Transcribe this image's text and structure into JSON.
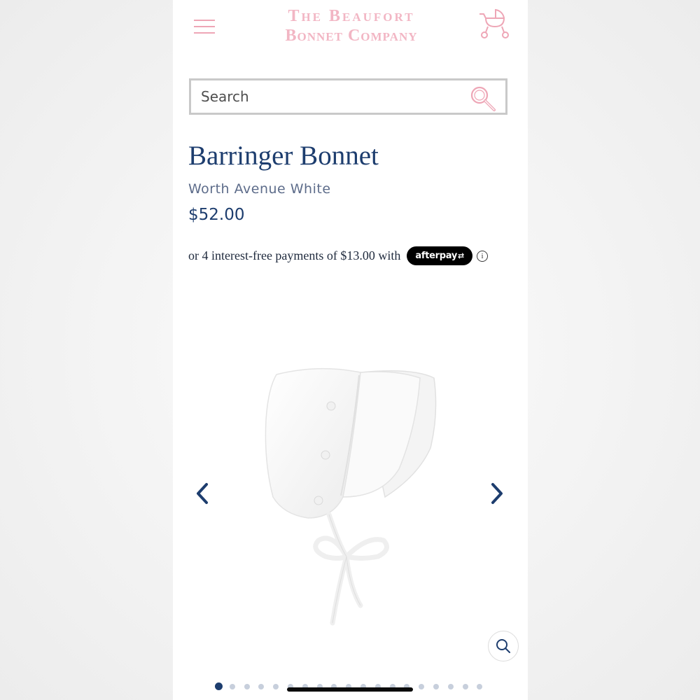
{
  "header": {
    "logo_line1": "The Beaufort",
    "logo_line2": "Bonnet Company",
    "brand_color": "#f2b6c4",
    "menu_icon": "hamburger-menu-icon",
    "cart_icon": "baby-carriage-cart-icon"
  },
  "search": {
    "placeholder": "Search",
    "value": "",
    "icon": "magnifying-glass-icon"
  },
  "product": {
    "title": "Barringer Bonnet",
    "variant": "Worth Avenue White",
    "price": "$52.00",
    "title_color": "#1d3d6e"
  },
  "payment": {
    "installments_text": "or 4 interest-free payments of $13.00 with",
    "provider_label": "afterpay",
    "provider_icon": "afterpay-arrows-icon",
    "info_icon_glyph": "i"
  },
  "gallery": {
    "image_subject": "white baby bonnet with ribbon ties",
    "prev_icon": "chevron-left-icon",
    "next_icon": "chevron-right-icon",
    "zoom_icon": "magnifying-glass-icon",
    "dot_count": 19,
    "active_dot": 0
  }
}
